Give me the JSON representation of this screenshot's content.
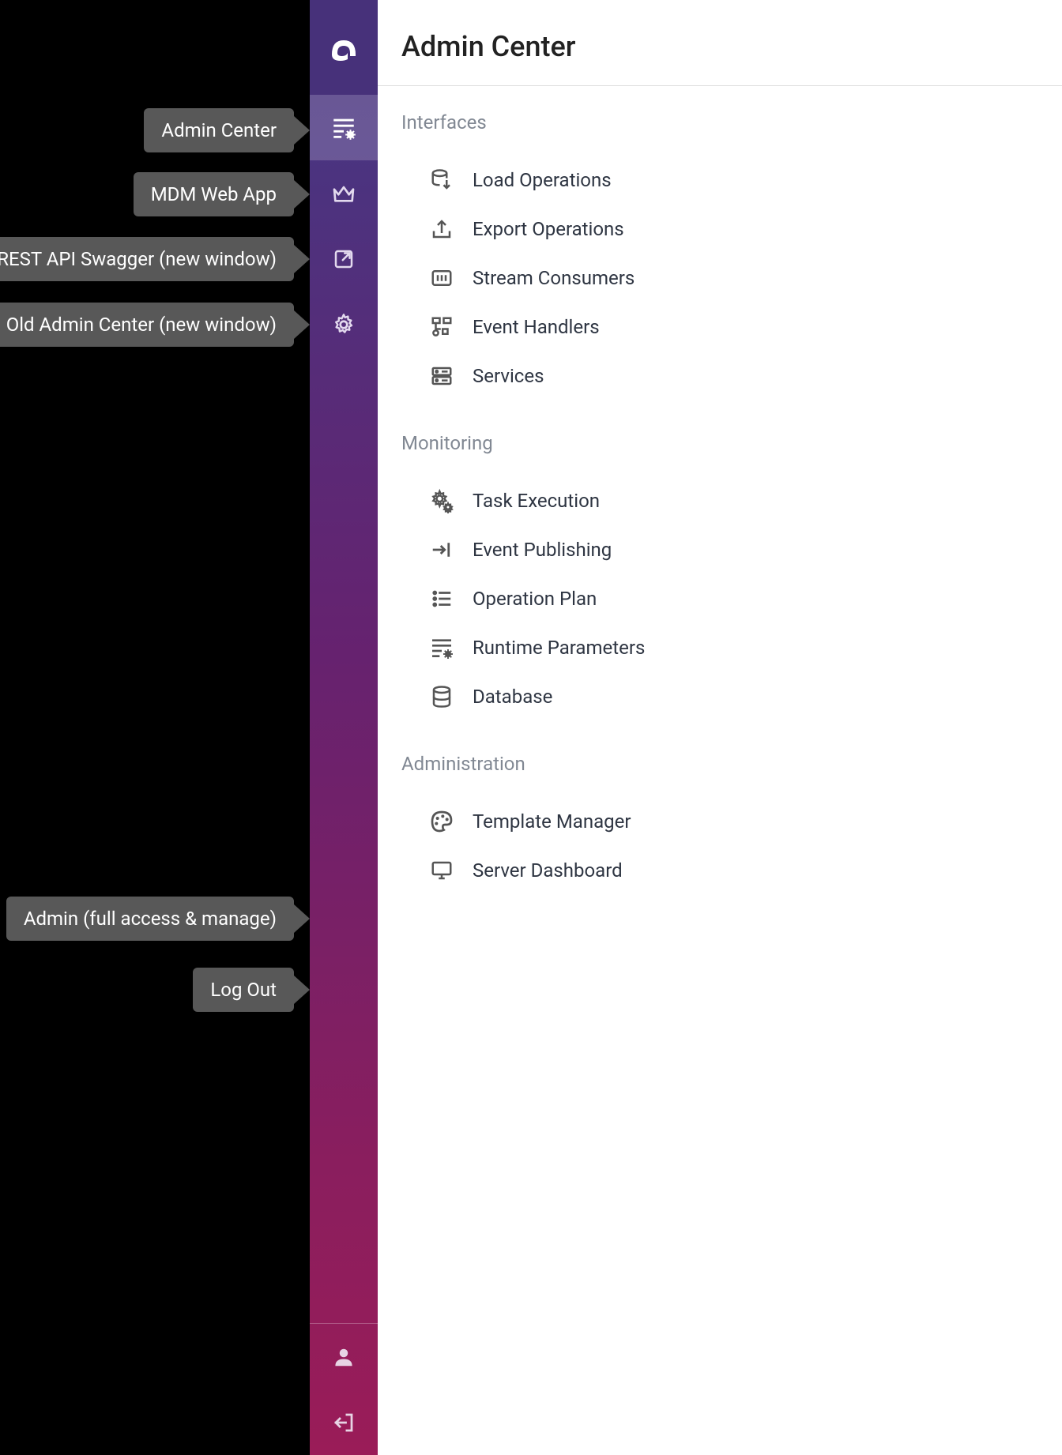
{
  "sidebar": {
    "tooltips": {
      "admin_center": "Admin Center",
      "mdm_web_app": "MDM Web App",
      "rest_api_swagger": "REST API Swagger (new window)",
      "old_admin_center": "Old Admin Center (new window)",
      "user": "Admin  (full access & manage)",
      "logout": "Log Out"
    }
  },
  "header": {
    "title": "Admin Center"
  },
  "sections": {
    "interfaces": {
      "title": "Interfaces",
      "items": {
        "load_operations": "Load Operations",
        "export_operations": "Export Operations",
        "stream_consumers": "Stream Consumers",
        "event_handlers": "Event Handlers",
        "services": "Services"
      }
    },
    "monitoring": {
      "title": "Monitoring",
      "items": {
        "task_execution": "Task Execution",
        "event_publishing": "Event Publishing",
        "operation_plan": "Operation Plan",
        "runtime_parameters": "Runtime Parameters",
        "database": "Database"
      }
    },
    "administration": {
      "title": "Administration",
      "items": {
        "template_manager": "Template Manager",
        "server_dashboard": "Server Dashboard"
      }
    }
  }
}
